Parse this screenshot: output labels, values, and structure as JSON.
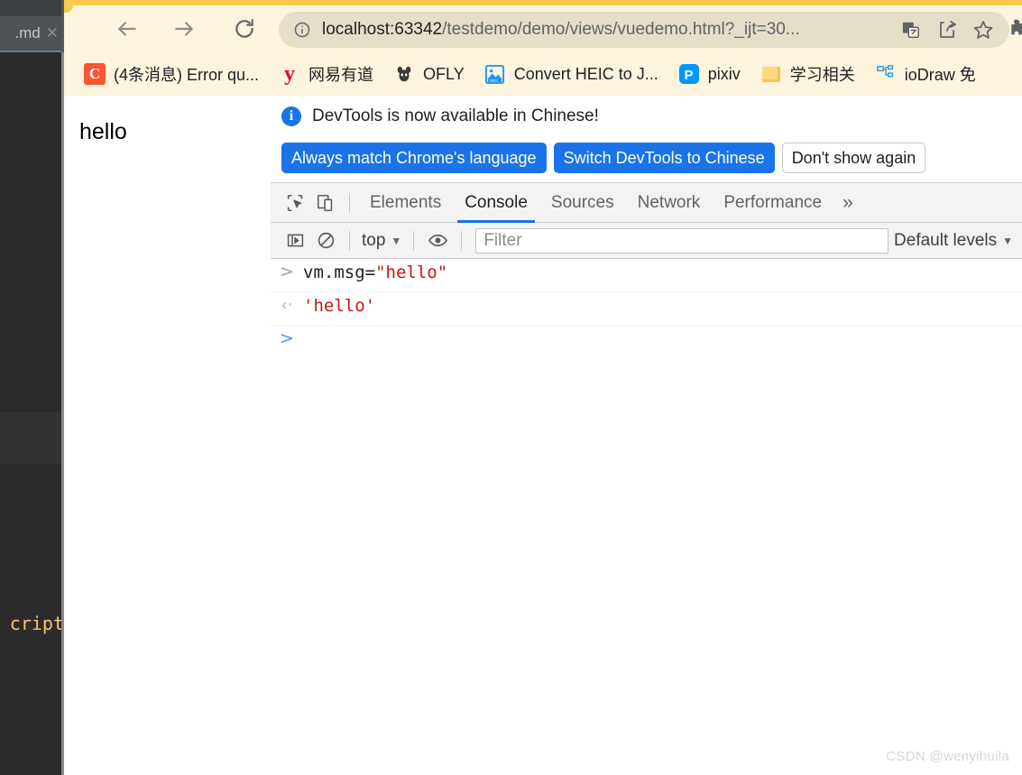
{
  "ide": {
    "tab_label": ".md",
    "close_icon": "close-icon",
    "code_fragment": "cript"
  },
  "browser": {
    "nav": {
      "back_icon": "back-arrow-icon",
      "forward_icon": "forward-arrow-icon",
      "reload_icon": "reload-icon"
    },
    "omnibox": {
      "info_icon": "info-circle-icon",
      "host": "localhost:63342",
      "path": "/testdemo/demo/views/vuedemo.html?_ijt=30...",
      "translate_icon": "translate-icon",
      "share_icon": "share-icon",
      "bookmark_icon": "star-icon"
    },
    "extensions_icon": "puzzle-piece-icon",
    "bookmarks": [
      {
        "label": "(4条消息) Error qu...",
        "icon": "csdn-favicon",
        "glyph": "C"
      },
      {
        "label": "网易有道",
        "icon": "youdao-favicon",
        "glyph": "y"
      },
      {
        "label": "OFLY",
        "icon": "ofly-favicon",
        "glyph": ""
      },
      {
        "label": "Convert HEIC to J...",
        "icon": "heic-favicon",
        "glyph": ""
      },
      {
        "label": "pixiv",
        "icon": "pixiv-favicon",
        "glyph": "P"
      },
      {
        "label": "学习相关",
        "icon": "folder-icon",
        "glyph": ""
      },
      {
        "label": "ioDraw 免",
        "icon": "iodraw-favicon",
        "glyph": ""
      }
    ]
  },
  "page": {
    "body_text": "hello"
  },
  "devtools": {
    "banner": {
      "info_icon": "info-badge-icon",
      "message": "DevTools is now available in Chinese!",
      "buttons": [
        {
          "label": "Always match Chrome's language",
          "style": "primary"
        },
        {
          "label": "Switch DevTools to Chinese",
          "style": "primary"
        },
        {
          "label": "Don't show again",
          "style": "secondary"
        }
      ]
    },
    "toolbar_icons": {
      "inspect": "inspect-element-icon",
      "device": "device-toolbar-icon"
    },
    "tabs": [
      {
        "label": "Elements",
        "active": false
      },
      {
        "label": "Console",
        "active": true
      },
      {
        "label": "Sources",
        "active": false
      },
      {
        "label": "Network",
        "active": false
      },
      {
        "label": "Performance",
        "active": false
      }
    ],
    "more_tabs": "»",
    "console_toolbar": {
      "sidebar_icon": "console-sidebar-icon",
      "clear_icon": "clear-console-icon",
      "context_label": "top",
      "context_caret": "▼",
      "eye_icon": "live-expression-eye-icon",
      "filter_placeholder": "Filter",
      "filter_value": "",
      "levels_label": "Default levels",
      "levels_caret": "▼"
    },
    "console_lines": [
      {
        "type": "input",
        "arrow": ">",
        "code_plain": "vm.msg=",
        "code_string": "\"hello\""
      },
      {
        "type": "output",
        "arrow": "‹·",
        "code_plain": "",
        "code_string": "'hello'"
      },
      {
        "type": "prompt",
        "arrow": ">",
        "code_plain": "",
        "code_string": ""
      }
    ]
  },
  "watermark": "CSDN @wenyihuila",
  "colors": {
    "chrome_bg": "#fdf4dd",
    "accent_yellow": "#fbc94d",
    "omnibox_bg": "#e5dfc8",
    "devtools_blue": "#1a73e8",
    "console_string_red": "#c41a16",
    "ide_bg": "#2b2b2b"
  }
}
